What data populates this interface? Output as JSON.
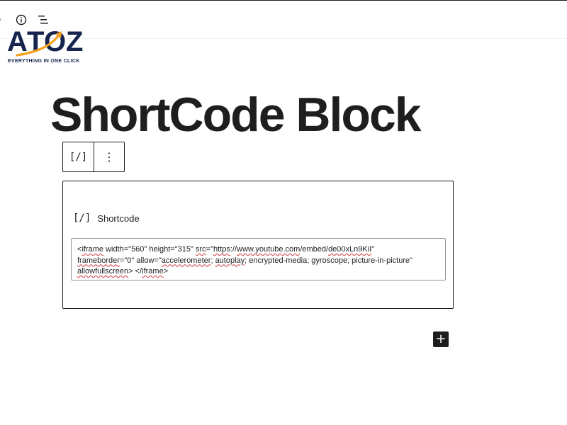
{
  "logo": {
    "word_a": "A",
    "word_t": "T",
    "word_o": "O",
    "word_z": "Z",
    "tagline": "EVERYTHING IN ONE CLICK",
    "brand_color": "#16244d",
    "accent_color": "#f5a01a"
  },
  "toolbar": {
    "icons": [
      "info-icon",
      "list-view-icon"
    ]
  },
  "page": {
    "title": "ShortCode Block"
  },
  "block_toolbar": {
    "block_type_icon": "[/]",
    "more_icon": "⋮"
  },
  "shortcode_block": {
    "label_icon": "[/]",
    "label": "Shortcode",
    "value": "<iframe width=\"560\" height=\"315\" src=\"https://www.youtube.com/embed/de00xLn9KiI\" frameborder=\"0\" allow=\"accelerometer; autoplay; encrypted-media; gyroscope; picture-in-picture\" allowfullscreen> </iframe>",
    "value_parts": {
      "p1": "<",
      "p2": "iframe",
      "p3": " width=\"560\" height=\"315\" ",
      "p4": "src",
      "p5": "=\"",
      "p6": "https",
      "p7": "://",
      "p8": "www.youtube.com",
      "p9": "/embed/",
      "p10": "de00xLn9KiI",
      "p11": "\"\n",
      "p12": "frameborder",
      "p13": "=\"0\" allow=\"",
      "p14": "accelerometer",
      "p15": "; ",
      "p16": "autoplay",
      "p17": "; encrypted-media; gyroscope; picture-in-picture\"\n",
      "p18": "allowfullscreen",
      "p19": "> </",
      "p20": "iframe",
      "p21": ">"
    }
  },
  "add_block": {
    "icon": "+"
  },
  "colors": {
    "text": "#1e1e1e",
    "spellcheck": "#d63638",
    "input_border": "#949494"
  }
}
